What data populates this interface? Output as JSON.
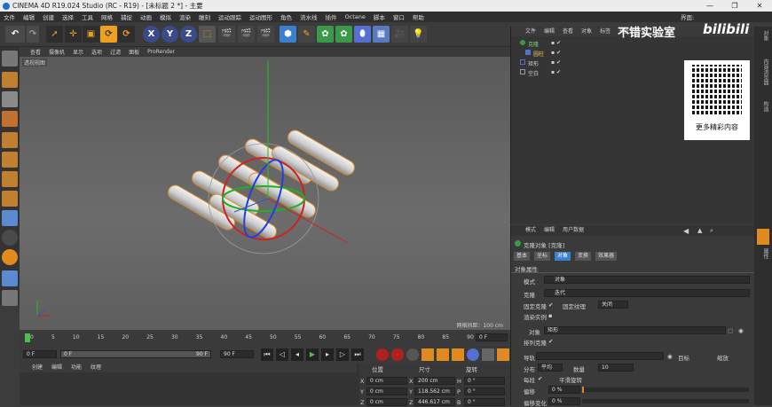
{
  "window": {
    "title": "CINEMA 4D R19.024 Studio (RC - R19) - [未标题 2 *] - 主要"
  },
  "menu": [
    "文件",
    "编辑",
    "创建",
    "选择",
    "工具",
    "网格",
    "捕捉",
    "动画",
    "模拟",
    "渲染",
    "雕刻",
    "运动跟踪",
    "运动图形",
    "角色",
    "流水线",
    "插件",
    "Octane",
    "脚本",
    "窗口",
    "帮助"
  ],
  "layout_label": "界面:",
  "toolbar": {
    "x": "X",
    "y": "Y",
    "z": "Z"
  },
  "viewport": {
    "menu": [
      "查看",
      "摄像机",
      "显示",
      "选项",
      "过滤",
      "面板",
      "ProRender"
    ],
    "label": "透视视图",
    "grid_info": "网格间距：100 cm"
  },
  "timeline": {
    "ticks": [
      "0",
      "5",
      "10",
      "15",
      "20",
      "25",
      "30",
      "35",
      "40",
      "45",
      "50",
      "55",
      "60",
      "65",
      "70",
      "75",
      "80",
      "85",
      "90"
    ],
    "frame": "0 F"
  },
  "controls": {
    "start": "0 F",
    "current": "0 F",
    "end": "90 F",
    "end2": "90 F"
  },
  "bottom": {
    "menu": [
      "创建",
      "编辑",
      "功能",
      "纹理"
    ],
    "coords_headers": [
      "位置",
      "尺寸",
      "旋转"
    ],
    "rows": [
      {
        "axis": "X",
        "pos": "0 cm",
        "size": "200 cm",
        "rot_axis": "H",
        "rot": "0 °"
      },
      {
        "axis": "Y",
        "pos": "0 cm",
        "size": "118.562 cm",
        "rot_axis": "P",
        "rot": "0 °"
      },
      {
        "axis": "Z",
        "pos": "0 cm",
        "size": "446.617 cm",
        "rot_axis": "B",
        "rot": "0 °"
      }
    ]
  },
  "objects": {
    "menu": [
      "文件",
      "编辑",
      "查看",
      "对象",
      "标签",
      "书签"
    ],
    "items": [
      {
        "name": "克隆",
        "color": "#7fd37f"
      },
      {
        "name": "圆柱",
        "color": "#e3c35a"
      },
      {
        "name": "矩形",
        "color": "#cfcfcf"
      },
      {
        "name": "空白",
        "color": "#cfcfcf"
      }
    ]
  },
  "watermark": {
    "text": "不错实验室",
    "brand": "bilibili",
    "qr_caption": "更多精彩内容"
  },
  "attributes": {
    "menu": [
      "模式",
      "编辑",
      "用户数据"
    ],
    "object_title": "克隆对象 [克隆]",
    "tabs": [
      "基本",
      "坐标",
      "对象",
      "变换",
      "效果器"
    ],
    "section": "对象属性",
    "mode_label": "模式",
    "mode_value": "对象",
    "clone_label": "克隆",
    "clone_value": "迭代",
    "fix_clone": "固定克隆",
    "fix_texture": "固定纹理",
    "fix_texture_value": "关闭",
    "render_instances": "渲染实例",
    "object_label": "对象",
    "object_value": "矩形",
    "sort_clones": "排列克隆",
    "guide_label": "导轨",
    "target_label": "目标",
    "scale_label": "缩放",
    "dist_label": "分布",
    "dist_value": "平均",
    "count_label": "数量",
    "count_value": "10",
    "each_seg": "每段",
    "smooth_rot": "平滑旋转",
    "offset_label": "偏移",
    "offset_value": "0 %",
    "offset_var_label": "偏移变化",
    "offset_var_value": "0 %"
  },
  "side_tabs": [
    "对象",
    "内容浏览器",
    "构造",
    "层",
    "属性"
  ]
}
